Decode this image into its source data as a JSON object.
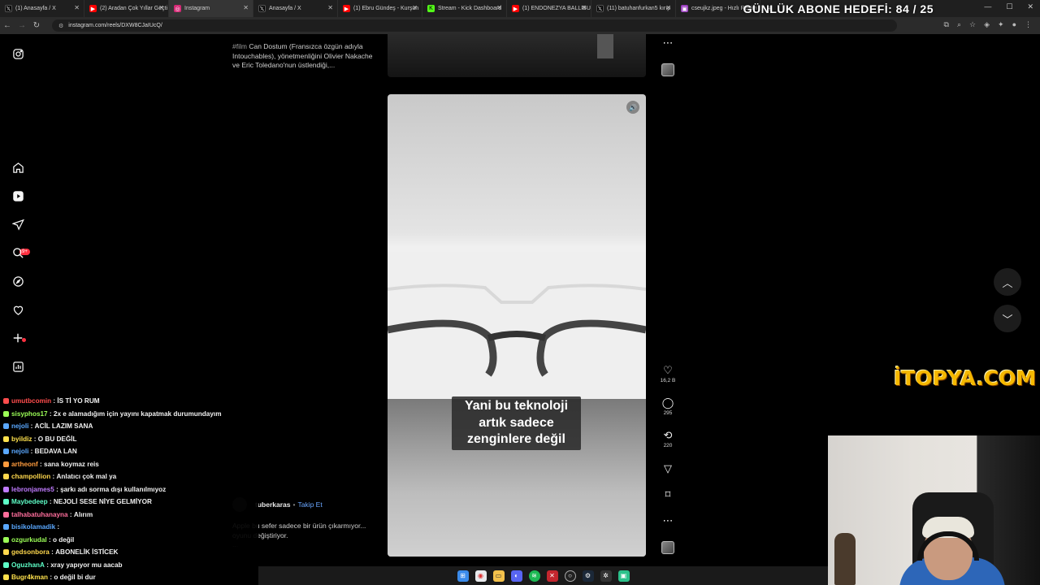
{
  "browser": {
    "tabs": [
      {
        "title": "(1) Anasayfa / X",
        "icon": "x-logo-icon",
        "color": "#000000"
      },
      {
        "title": "(2) Aradan Çok Yıllar Geçti",
        "icon": "youtube-icon",
        "color": "#ff0000"
      },
      {
        "title": "Instagram",
        "icon": "instagram-icon",
        "color": "#d62976"
      },
      {
        "title": "Anasayfa / X",
        "icon": "x-logo-icon",
        "color": "#000000"
      },
      {
        "title": "(1) Ebru Gündeş - Kurşun",
        "icon": "youtube-icon",
        "color": "#ff0000"
      },
      {
        "title": "Stream - Kick Dashboard",
        "icon": "kick-icon",
        "color": "#53fc18"
      },
      {
        "title": "(1) ENDONEZYA BALLIBU",
        "icon": "youtube-icon",
        "color": "#ff0000"
      },
      {
        "title": "(11) batuhanfurkan5 kırıp",
        "icon": "x-logo-icon",
        "color": "#000000"
      },
      {
        "title": "cseujkz.jpeg - Hızlı Resim",
        "icon": "image-icon",
        "color": "#9b3fbf"
      }
    ],
    "url": "instagram.com/reels/DXW8CJaIUcQ/"
  },
  "stream_overlay": {
    "goal_text": "GÜNLÜK ABONE HEDEFİ: 84 / 25",
    "sponsor_logo": "İTOPYA.COM"
  },
  "instagram": {
    "rail_icons": [
      "instagram-logo-icon",
      "home-icon",
      "reels-icon",
      "messages-icon",
      "search-icon",
      "explore-icon",
      "notifications-icon",
      "create-icon",
      "dashboard-icon"
    ],
    "messages_badge": "9+",
    "prev_reel": {
      "hashtag": "#film",
      "caption": "Can Dostum (Fransızca özgün adıyla Intouchables), yönetmenliğini Olivier Nakache ve Eric Toledano'nun üstlendiği,..."
    },
    "reel": {
      "subtitle": "Yani bu teknoloji artık sadece zenginlere değil",
      "author": "tuberkaras",
      "separator": "•",
      "follow_label": "Takip Et",
      "caption": "Apple bu sefer sadece bir ürün çıkarmıyor... oyunu değiştiriyor.",
      "more": "..."
    },
    "actions": {
      "likes": "16,2 B",
      "comments": "295",
      "reposts": "220"
    }
  },
  "chat": [
    {
      "user": "umutbcomin",
      "color": "#ff4d4d",
      "msg": "İS Tİ YO RUM"
    },
    {
      "user": "sisyphos17",
      "color": "#9cff57",
      "msg": "2x e alamadığım için yayını kapatmak durumundayım"
    },
    {
      "user": "nejoli",
      "color": "#5aa8ff",
      "msg": "ACİL LAZIM SANA"
    },
    {
      "user": "byildiz",
      "color": "#ffe24d",
      "msg": "O BU DEĞİL"
    },
    {
      "user": "nejoli",
      "color": "#5aa8ff",
      "msg": "BEDAVA LAN"
    },
    {
      "user": "artheonf",
      "color": "#ff9b3d",
      "msg": "sana koymaz reis"
    },
    {
      "user": "champollion",
      "color": "#ffd84d",
      "msg": "Anlatıcı çok mal ya"
    },
    {
      "user": "lebronjames5",
      "color": "#c07bff",
      "msg": "şarkı adı sorma dışı kullanılmıyoz"
    },
    {
      "user": "Maybedeep",
      "color": "#5effc8",
      "msg": "NEJOLİ SESE NİYE GELMİYOR"
    },
    {
      "user": "talhabatuhanayna",
      "color": "#ff6e9c",
      "msg": "Alırım"
    },
    {
      "user": "bisikolamadik",
      "color": "#5aa8ff",
      "msg": ""
    },
    {
      "user": "ozgurkudal",
      "color": "#9cff57",
      "msg": "o değil"
    },
    {
      "user": "gedsonbora",
      "color": "#ffd84d",
      "msg": "ABONELİK İSTİCEK"
    },
    {
      "user": "OguzhanA",
      "color": "#5effc8",
      "msg": "xray yapıyor mu aacab"
    },
    {
      "user": "Bugr4kman",
      "color": "#ffe24d",
      "msg": "o değil bi dur"
    }
  ],
  "taskbar_icons": [
    "windows-start-icon",
    "chrome-icon",
    "file-explorer-icon",
    "discord-icon",
    "spotify-icon",
    "xsplit-icon",
    "obs-icon",
    "steam-icon",
    "settings-icon",
    "app-icon"
  ]
}
